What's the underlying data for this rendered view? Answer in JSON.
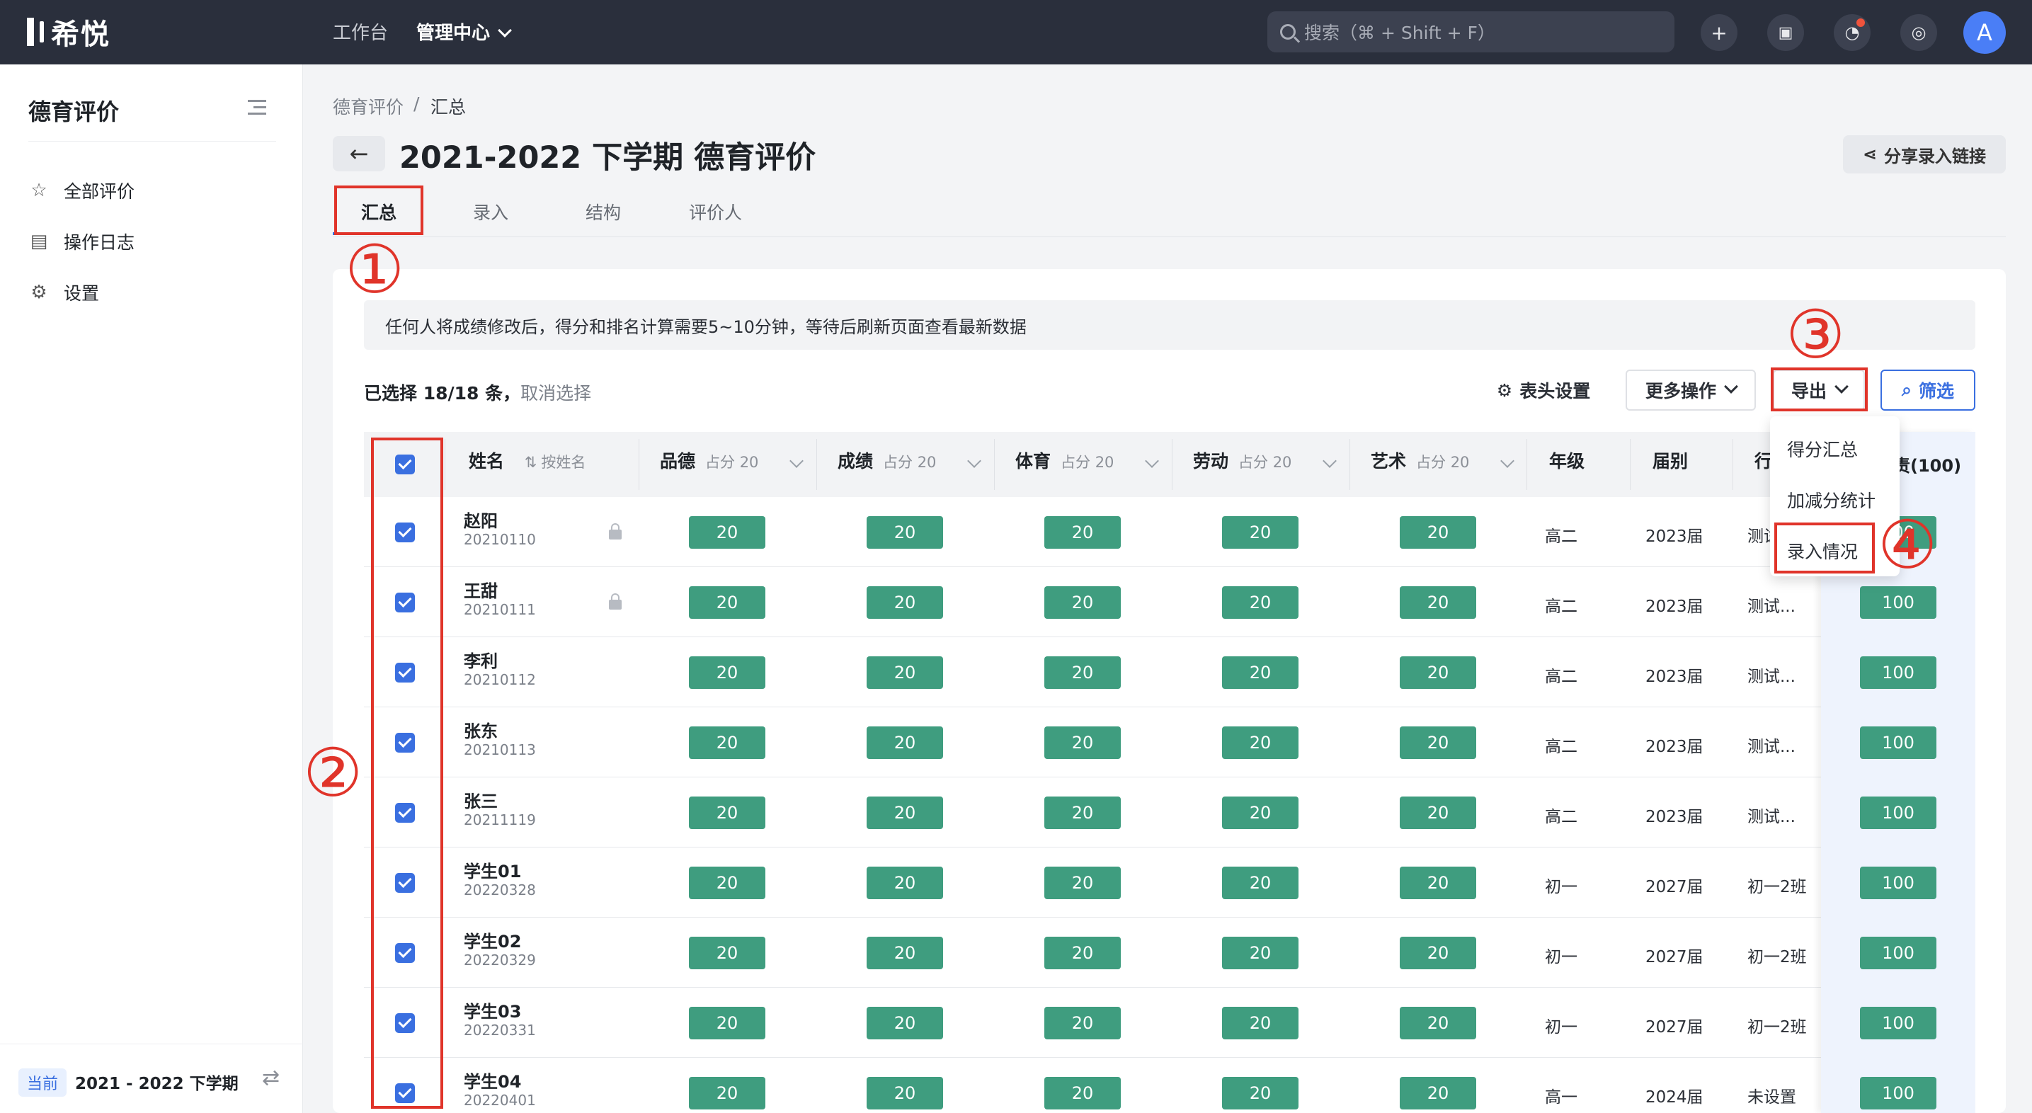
{
  "topbar": {
    "logo": "希悦",
    "nav_workbench": "工作台",
    "nav_admin": "管理中心",
    "search_placeholder": "搜索（⌘ + Shift + F）",
    "avatar_letter": "A"
  },
  "sidebar": {
    "title": "德育评价",
    "items": [
      {
        "label": "全部评价",
        "icon": "star-icon"
      },
      {
        "label": "操作日志",
        "icon": "log-icon"
      },
      {
        "label": "设置",
        "icon": "gear-icon"
      }
    ],
    "current_badge": "当前",
    "current_term": "2021 - 2022 下学期"
  },
  "breadcrumb": {
    "root": "德育评价",
    "sep": "/",
    "current": "汇总"
  },
  "page": {
    "title": "2021-2022 下学期 德育评价",
    "share_label": "分享录入链接"
  },
  "tabs": [
    "汇总",
    "录入",
    "结构",
    "评价人"
  ],
  "annotations": {
    "c1": "①",
    "c2": "②",
    "c3": "③",
    "c4": "④"
  },
  "notice": "任何人将成绩修改后，得分和排名计算需要5~10分钟，等待后刷新页面查看最新数据",
  "selection": {
    "text": "已选择 18/18 条，",
    "cancel": "取消选择"
  },
  "actions": {
    "column_settings": "表头设置",
    "more": "更多操作",
    "export": "导出",
    "filter": "筛选"
  },
  "export_menu": [
    "得分汇总",
    "加减分统计",
    "录入情况"
  ],
  "table": {
    "headers": {
      "name": "姓名",
      "sort": "按姓名",
      "pinde": "品德",
      "chengji": "成绩",
      "tiyu": "体育",
      "laodong": "劳动",
      "yishu": "艺术",
      "weight": "占分 20",
      "grade": "年级",
      "cohort": "届别",
      "class_partial": "行",
      "total_partial": "责(100)"
    },
    "rows": [
      {
        "name": "赵阳",
        "id": "20210110",
        "locked": true,
        "scores": [
          "20",
          "20",
          "20",
          "20",
          "20"
        ],
        "grade": "高二",
        "cohort": "2023届",
        "class": "测试...",
        "total": "100"
      },
      {
        "name": "王甜",
        "id": "20210111",
        "locked": true,
        "scores": [
          "20",
          "20",
          "20",
          "20",
          "20"
        ],
        "grade": "高二",
        "cohort": "2023届",
        "class": "测试...",
        "total": "100"
      },
      {
        "name": "李利",
        "id": "20210112",
        "locked": false,
        "scores": [
          "20",
          "20",
          "20",
          "20",
          "20"
        ],
        "grade": "高二",
        "cohort": "2023届",
        "class": "测试...",
        "total": "100"
      },
      {
        "name": "张东",
        "id": "20210113",
        "locked": false,
        "scores": [
          "20",
          "20",
          "20",
          "20",
          "20"
        ],
        "grade": "高二",
        "cohort": "2023届",
        "class": "测试...",
        "total": "100"
      },
      {
        "name": "张三",
        "id": "20211119",
        "locked": false,
        "scores": [
          "20",
          "20",
          "20",
          "20",
          "20"
        ],
        "grade": "高二",
        "cohort": "2023届",
        "class": "测试...",
        "total": "100"
      },
      {
        "name": "学生01",
        "id": "20220328",
        "locked": false,
        "scores": [
          "20",
          "20",
          "20",
          "20",
          "20"
        ],
        "grade": "初一",
        "cohort": "2027届",
        "class": "初一2班",
        "total": "100"
      },
      {
        "name": "学生02",
        "id": "20220329",
        "locked": false,
        "scores": [
          "20",
          "20",
          "20",
          "20",
          "20"
        ],
        "grade": "初一",
        "cohort": "2027届",
        "class": "初一2班",
        "total": "100"
      },
      {
        "name": "学生03",
        "id": "20220331",
        "locked": false,
        "scores": [
          "20",
          "20",
          "20",
          "20",
          "20"
        ],
        "grade": "初一",
        "cohort": "2027届",
        "class": "初一2班",
        "total": "100"
      },
      {
        "name": "学生04",
        "id": "20220401",
        "locked": false,
        "scores": [
          "20",
          "20",
          "20",
          "20",
          "20"
        ],
        "grade": "高一",
        "cohort": "2024届",
        "class": "未设置",
        "total": "100"
      }
    ]
  },
  "colors": {
    "accent": "#3a6fe0",
    "score_bg": "#3f9d7f",
    "annotation": "#e0342a",
    "topbar": "#2a2f3c"
  }
}
